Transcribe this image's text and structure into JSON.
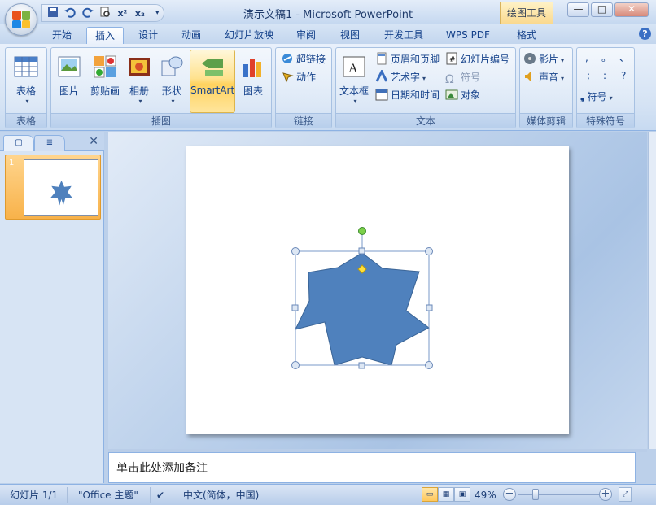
{
  "window": {
    "title": "演示文稿1 - Microsoft PowerPoint",
    "context_tab": "绘图工具",
    "minimize": "—",
    "restore": "□",
    "close": "✕"
  },
  "qat": {
    "icons": [
      "save-icon",
      "undo-icon",
      "redo-icon",
      "print-preview-icon",
      "superscript-icon",
      "subscript-icon",
      "customize-icon"
    ],
    "superscript_label": "x²",
    "subscript_label": "x₂"
  },
  "tabs": [
    {
      "label": "开始"
    },
    {
      "label": "插入",
      "active": true
    },
    {
      "label": "设计"
    },
    {
      "label": "动画"
    },
    {
      "label": "幻灯片放映"
    },
    {
      "label": "审阅"
    },
    {
      "label": "视图"
    },
    {
      "label": "开发工具"
    },
    {
      "label": "WPS PDF"
    },
    {
      "label": "格式"
    }
  ],
  "ribbon": {
    "groups": {
      "table": "表格",
      "illustrations": "插图",
      "links": "链接",
      "text": "文本",
      "media": "媒体剪辑",
      "symbols": "特殊符号"
    },
    "buttons": {
      "table": "表格",
      "picture": "图片",
      "clipart": "剪贴画",
      "album": "相册",
      "shapes": "形状",
      "smartart": "SmartArt",
      "chart": "图表",
      "hyperlink": "超链接",
      "action": "动作",
      "textbox": "文本框",
      "header_footer": "页眉和页脚",
      "wordart": "艺术字",
      "datetime": "日期和时间",
      "slide_number": "幻灯片编号",
      "symbol": "符号",
      "object": "对象",
      "movie": "影片",
      "sound": "声音",
      "special_symbol": "符号"
    },
    "punct": [
      ",",
      "。",
      "、",
      ";",
      ":",
      "?"
    ]
  },
  "left_pane": {
    "slide_number": "1",
    "close": "✕"
  },
  "notes": {
    "placeholder": "单击此处添加备注"
  },
  "status": {
    "slide": "幻灯片 1/1",
    "theme": "\"Office 主题\"",
    "language": "中文(简体，中国)",
    "zoom": "49%"
  },
  "colors": {
    "shape_fill": "#4f81bd",
    "shape_stroke": "#3a6496",
    "accent": "#ffd25e"
  }
}
